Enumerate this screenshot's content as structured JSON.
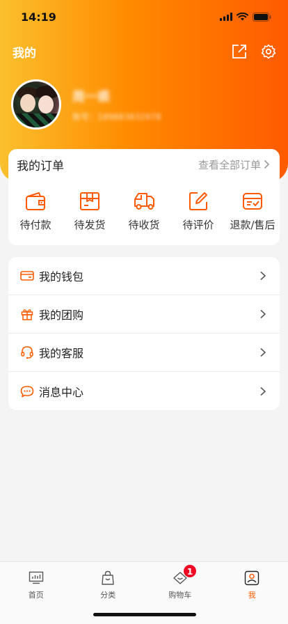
{
  "status": {
    "time": "14:19"
  },
  "header": {
    "title": "我的"
  },
  "profile": {
    "name": "周一裘",
    "account": "账号：189883832978"
  },
  "orders": {
    "title": "我的订单",
    "view_all": "查看全部订单",
    "items": [
      {
        "label": "待付款",
        "icon": "wallet-icon"
      },
      {
        "label": "待发货",
        "icon": "box-icon"
      },
      {
        "label": "待收货",
        "icon": "truck-icon"
      },
      {
        "label": "待评价",
        "icon": "edit-icon"
      },
      {
        "label": "退款/售后",
        "icon": "refund-icon"
      }
    ]
  },
  "menu": {
    "items": [
      {
        "label": "我的钱包",
        "icon": "card-icon"
      },
      {
        "label": "我的团购",
        "icon": "gift-icon"
      },
      {
        "label": "我的客服",
        "icon": "headset-icon"
      },
      {
        "label": "消息中心",
        "icon": "message-icon"
      }
    ]
  },
  "tabbar": {
    "items": [
      {
        "label": "首页",
        "icon": "home-icon"
      },
      {
        "label": "分类",
        "icon": "bag-icon"
      },
      {
        "label": "购物车",
        "icon": "cart-icon",
        "badge": "1"
      },
      {
        "label": "我",
        "icon": "user-icon",
        "active": true
      }
    ]
  },
  "colors": {
    "accent": "#ff5a00",
    "gradient_start": "#fbc02d",
    "gradient_end": "#ff5a00",
    "badge": "#ee0a24"
  }
}
